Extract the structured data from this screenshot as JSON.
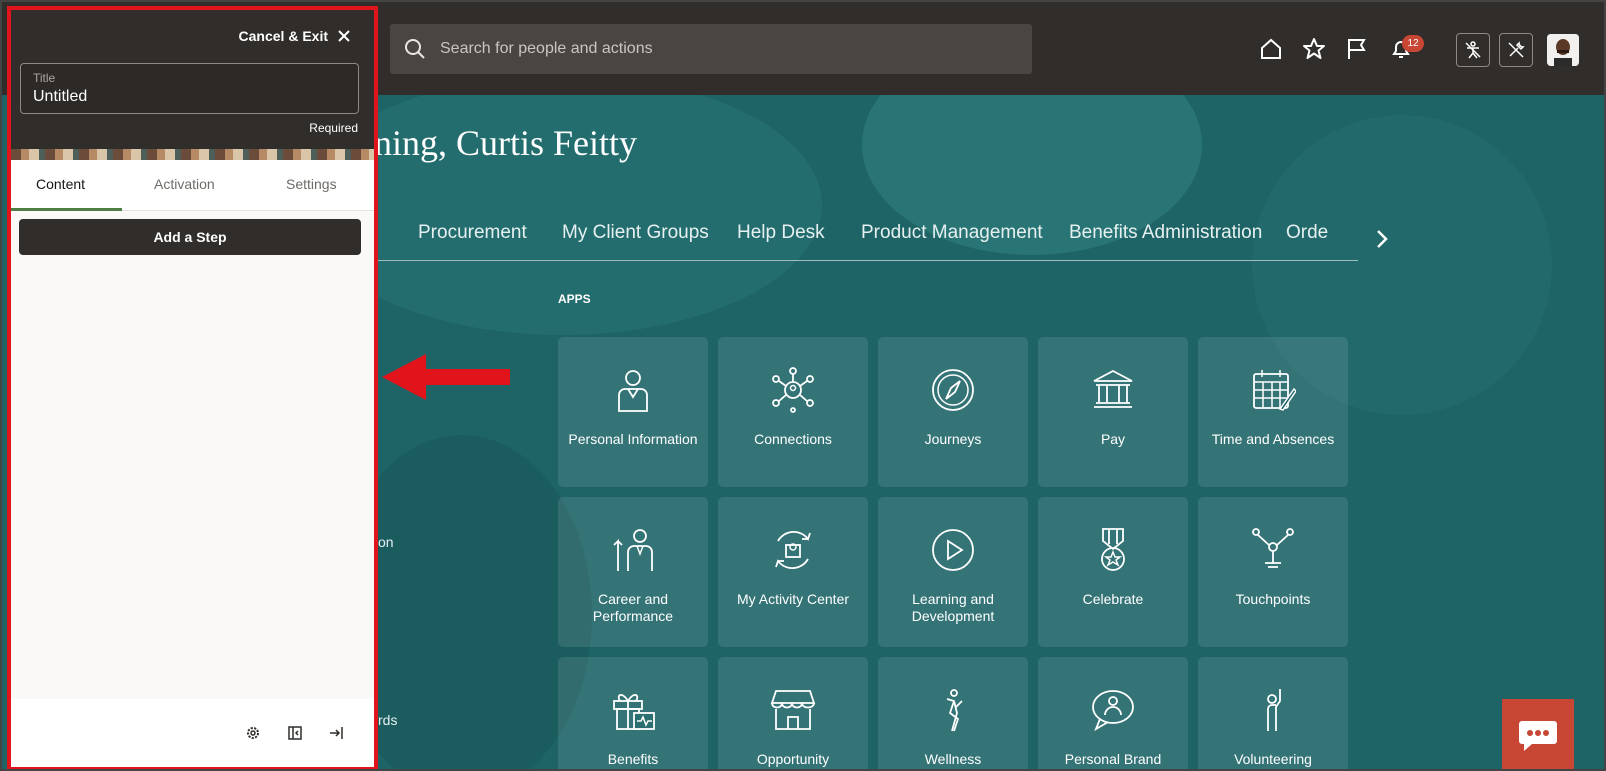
{
  "header": {
    "search_placeholder": "Search for people and actions",
    "notification_count": "12",
    "icons": [
      "home-icon",
      "star-icon",
      "flag-icon",
      "bell-icon",
      "accessibility-off-icon",
      "tools-icon",
      "avatar"
    ]
  },
  "main": {
    "greeting": "rning, Curtis Feitty",
    "nav": [
      "Procurement",
      "My Client Groups",
      "Help Desk",
      "Product Management",
      "Benefits Administration",
      "Orde"
    ],
    "apps_label": "APPS",
    "side_fragments": [
      "on",
      "rds"
    ],
    "tiles": [
      {
        "label": "Personal Information",
        "icon": "person-icon"
      },
      {
        "label": "Connections",
        "icon": "network-icon"
      },
      {
        "label": "Journeys",
        "icon": "compass-icon"
      },
      {
        "label": "Pay",
        "icon": "bank-icon"
      },
      {
        "label": "Time and Absences",
        "icon": "calendar-icon"
      },
      {
        "label": "Career and Performance",
        "icon": "career-icon"
      },
      {
        "label": "My Activity Center",
        "icon": "activity-icon"
      },
      {
        "label": "Learning and Development",
        "icon": "play-icon"
      },
      {
        "label": "Celebrate",
        "icon": "medal-icon"
      },
      {
        "label": "Touchpoints",
        "icon": "touchpoints-icon"
      },
      {
        "label": "Benefits",
        "icon": "gift-icon"
      },
      {
        "label": "Opportunity Marketplace",
        "icon": "store-icon"
      },
      {
        "label": "Wellness",
        "icon": "wellness-icon"
      },
      {
        "label": "Personal Brand",
        "icon": "speech-icon"
      },
      {
        "label": "Volunteering",
        "icon": "volunteer-icon"
      }
    ]
  },
  "panel": {
    "cancel_label": "Cancel & Exit",
    "title_label": "Title",
    "title_value": "Untitled",
    "required_label": "Required",
    "tabs": [
      "Content",
      "Activation",
      "Settings"
    ],
    "add_step_label": "Add a Step",
    "footer_icons": [
      "gear-icon",
      "panel-toggle-icon",
      "exit-icon"
    ]
  },
  "colors": {
    "header_bg": "#312d2a",
    "main_bg": "#1e6467",
    "highlight": "#e0141a",
    "badge": "#c74634"
  }
}
